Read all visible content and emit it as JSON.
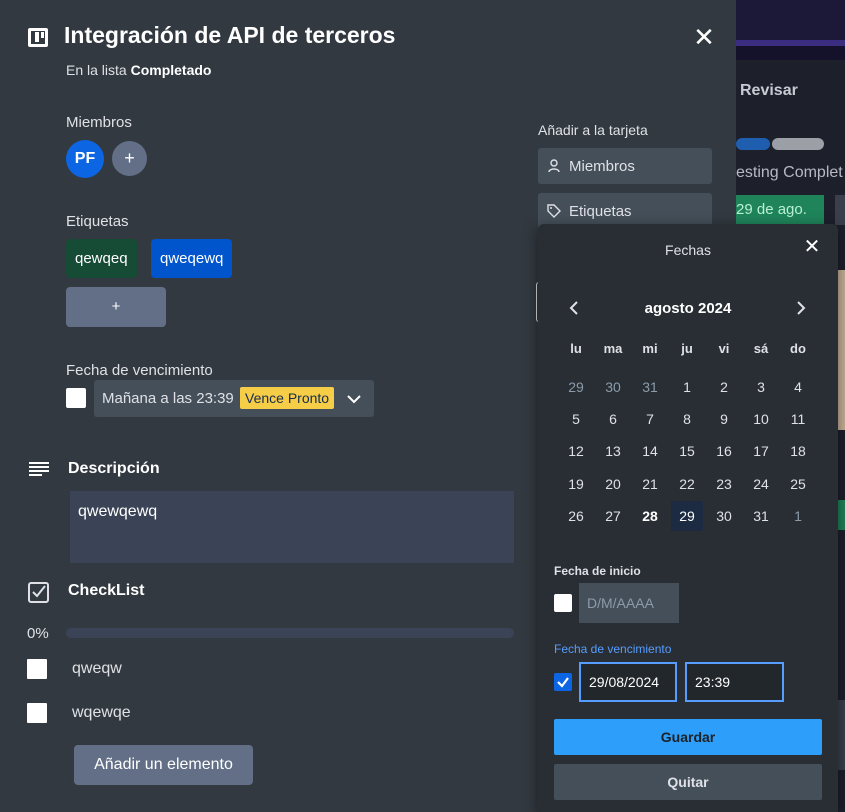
{
  "card": {
    "title": "Integración de API de terceros",
    "in_list_prefix": "En la lista",
    "list_name": "Completado"
  },
  "members": {
    "label": "Miembros",
    "avatar_initials": "PF",
    "add_label": "+"
  },
  "labels": {
    "label": "Etiquetas",
    "items": [
      {
        "text": "qewqeq",
        "color": "#164b35"
      },
      {
        "text": "qweqewq",
        "color": "#0055cc"
      }
    ],
    "add_label": "+"
  },
  "due": {
    "label": "Fecha de vencimiento",
    "value": "Mañana a las 23:39",
    "badge": "Vence Pronto",
    "badge_color": "#f5cd47"
  },
  "description": {
    "title": "Descripción",
    "text": "qwewqewq"
  },
  "checklist": {
    "title": "CheckList",
    "percent": "0%",
    "progress_fraction": 0,
    "items": [
      "qweqw",
      "wqewqe"
    ],
    "add_item_label": "Añadir un elemento"
  },
  "sidebar": {
    "title": "Añadir a la tarjeta",
    "members_btn": "Miembros",
    "labels_btn": "Etiquetas"
  },
  "board_background": {
    "column_title": "Revisar",
    "card_title": "esting Complet",
    "card_date": "29 de ago."
  },
  "dates_popover": {
    "title": "Fechas",
    "month": "agosto 2024",
    "weekdays": [
      "lu",
      "ma",
      "mi",
      "ju",
      "vi",
      "sá",
      "do"
    ],
    "weeks": [
      [
        "29",
        "30",
        "31",
        "1",
        "2",
        "3",
        "4"
      ],
      [
        "5",
        "6",
        "7",
        "8",
        "9",
        "10",
        "11"
      ],
      [
        "12",
        "13",
        "14",
        "15",
        "16",
        "17",
        "18"
      ],
      [
        "19",
        "20",
        "21",
        "22",
        "23",
        "24",
        "25"
      ],
      [
        "26",
        "27",
        "28",
        "29",
        "30",
        "31",
        "1"
      ]
    ],
    "today": "28",
    "selected": "29",
    "start_label": "Fecha de inicio",
    "start_placeholder": "D/M/AAAA",
    "due_label": "Fecha de vencimiento",
    "due_date": "29/08/2024",
    "due_time": "23:39",
    "save_label": "Guardar",
    "remove_label": "Quitar"
  },
  "colors": {
    "modal_bg": "#323940",
    "popover_bg": "#282e33",
    "accent": "#579dff",
    "save_button": "#2d9ef9"
  }
}
